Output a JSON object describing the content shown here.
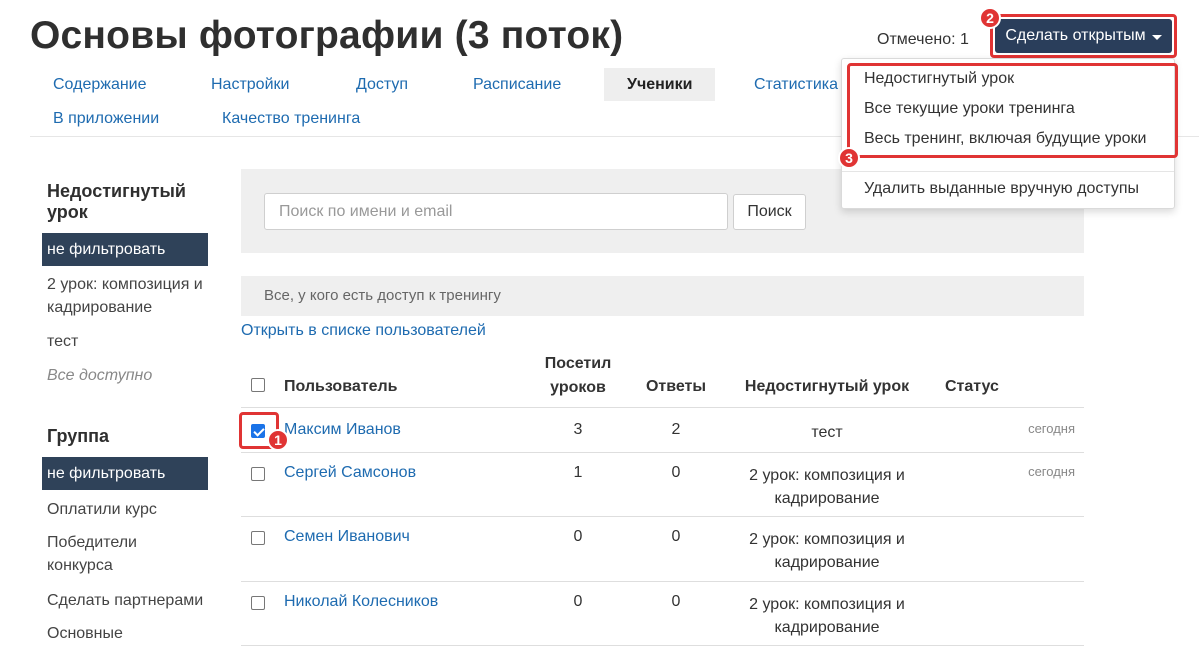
{
  "header": {
    "title": "Основы фотографии (3 поток)",
    "marked_text": "Отмечено: 1",
    "make_open_button": "Сделать открытым"
  },
  "tabs": [
    {
      "label": "Содержание"
    },
    {
      "label": "Настройки"
    },
    {
      "label": "Доступ"
    },
    {
      "label": "Расписание"
    },
    {
      "label": "Ученики",
      "active": true
    },
    {
      "label": "Статистика"
    },
    {
      "label": "В приложении"
    },
    {
      "label": "Качество тренинга"
    }
  ],
  "dropdown": {
    "items": [
      "Недостигнутый урок",
      "Все текущие уроки тренинга",
      "Весь тренинг, включая будущие уроки",
      "Удалить выданные вручную доступы"
    ]
  },
  "markers": [
    "1",
    "2",
    "3"
  ],
  "sidebar": {
    "lesson_filter": {
      "heading": "Недостигнутый урок",
      "items": [
        "не фильтровать",
        "2 урок: композиция и кадрирование",
        "тест",
        "Все доступно"
      ]
    },
    "group_filter": {
      "heading": "Группа",
      "items": [
        "не фильтровать",
        "Оплатили курс",
        "Победители конкурса",
        "Сделать партнерами",
        "Основные"
      ]
    }
  },
  "search": {
    "placeholder": "Поиск по имени и email",
    "button": "Поиск"
  },
  "filter_bar": "Все, у кого есть доступ к тренингу",
  "open_in_users_link": "Открыть в списке пользователей",
  "table": {
    "headers": {
      "user": "Пользователь",
      "visited": "Посетил уроков",
      "answers": "Ответы",
      "lesson": "Недостигнутый урок",
      "status": "Статус"
    },
    "rows": [
      {
        "name": "Максим Иванов",
        "visited": "3",
        "answers": "2",
        "lesson": "тест",
        "status": "сегодня",
        "checked": true
      },
      {
        "name": "Сергей Самсонов",
        "visited": "1",
        "answers": "0",
        "lesson": "2 урок: композиция и кадрирование",
        "status": "сегодня",
        "checked": false
      },
      {
        "name": "Семен Иванович",
        "visited": "0",
        "answers": "0",
        "lesson": "2 урок: композиция и кадрирование",
        "status": "",
        "checked": false
      },
      {
        "name": "Николай Колесников",
        "visited": "0",
        "answers": "0",
        "lesson": "2 урок: композиция и кадрирование",
        "status": "",
        "checked": false
      }
    ]
  },
  "colors": {
    "primary": "#2a3e5b",
    "link": "#1e6bb0",
    "highlight": "#e03434",
    "sidebar_active": "#2f4259"
  }
}
